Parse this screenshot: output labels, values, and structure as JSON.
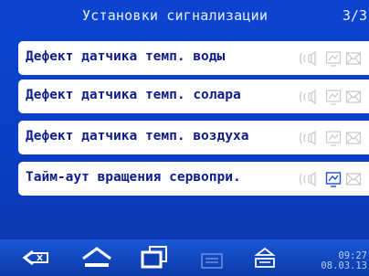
{
  "header": {
    "title": "Установки сигнализации",
    "page_indicator": "3/3"
  },
  "alarms": [
    {
      "label": "Дефект датчика темп. воды",
      "highlighted": false
    },
    {
      "label": "Дефект датчика темп. солара",
      "highlighted": false
    },
    {
      "label": "Дефект датчика темп. воздуха",
      "highlighted": false
    },
    {
      "label": "Тайм-аут вращения сервопри.",
      "highlighted": true
    }
  ],
  "row_icons": [
    "sound-icon",
    "display-alert-icon",
    "email-icon"
  ],
  "colors": {
    "background": "#0a3fc4",
    "row_text": "#0e1d8a",
    "icon_dim": "#c9c9c9",
    "icon_active": "#1d4fd0"
  },
  "taskbar": {
    "buttons": [
      "back-icon",
      "home-icon",
      "windows-icon",
      "menu-icon",
      "eject-icon"
    ],
    "time": "09:27",
    "date": "08.03.13"
  }
}
